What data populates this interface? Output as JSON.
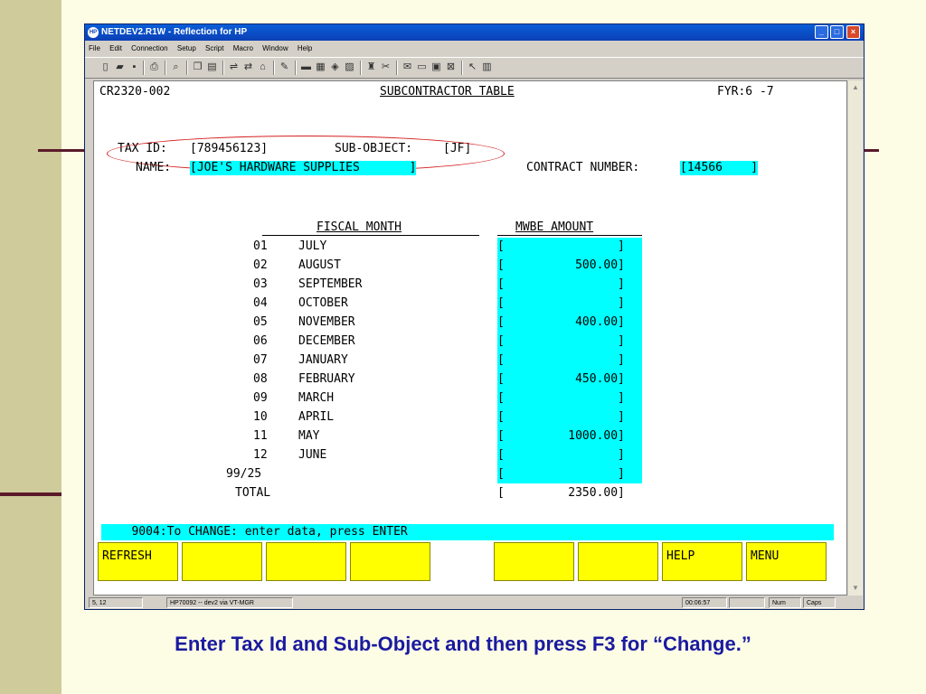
{
  "window": {
    "title": "NETDEV2.R1W - Reflection for HP",
    "app_icon": "HP",
    "controls": {
      "minimize": "_",
      "maximize": "□",
      "close": "×"
    }
  },
  "menu": [
    "File",
    "Edit",
    "Connection",
    "Setup",
    "Script",
    "Macro",
    "Window",
    "Help"
  ],
  "terminal": {
    "screen_id": "CR2320-002",
    "title": "SUBCONTRACTOR TABLE",
    "fiscal_year": "FYR:6 -7",
    "tax_id_label": "TAX ID:",
    "tax_id_value": "[789456123]",
    "sub_object_label": "SUB-OBJECT:",
    "sub_object_value": "[JF]",
    "name_label": "NAME:",
    "name_value": "[JOE'S HARDWARE SUPPLIES       ]",
    "contract_label": "CONTRACT NUMBER:",
    "contract_value": "[14566    ]",
    "col_fiscal_month": "FISCAL MONTH",
    "col_mwbe_amount": "MWBE AMOUNT",
    "rows": [
      {
        "num": "01",
        "month": "JULY",
        "amount": "[                ]"
      },
      {
        "num": "02",
        "month": "AUGUST",
        "amount": "[          500.00]"
      },
      {
        "num": "03",
        "month": "SEPTEMBER",
        "amount": "[                ]"
      },
      {
        "num": "04",
        "month": "OCTOBER",
        "amount": "[                ]"
      },
      {
        "num": "05",
        "month": "NOVEMBER",
        "amount": "[          400.00]"
      },
      {
        "num": "06",
        "month": "DECEMBER",
        "amount": "[                ]"
      },
      {
        "num": "07",
        "month": "JANUARY",
        "amount": "[                ]"
      },
      {
        "num": "08",
        "month": "FEBRUARY",
        "amount": "[          450.00]"
      },
      {
        "num": "09",
        "month": "MARCH",
        "amount": "[                ]"
      },
      {
        "num": "10",
        "month": "APRIL",
        "amount": "[                ]"
      },
      {
        "num": "11",
        "month": "MAY",
        "amount": "[         1000.00]"
      },
      {
        "num": "12",
        "month": "JUNE",
        "amount": "[                ]"
      },
      {
        "num": "99/25",
        "month": "",
        "amount": "[                ]"
      }
    ],
    "total_label": "TOTAL",
    "total_value": "[         2350.00]",
    "message": "   9004:To CHANGE: enter data, press ENTER",
    "function_keys": [
      "REFRESH",
      "",
      "",
      "",
      "",
      "",
      "",
      "HELP",
      "MENU"
    ]
  },
  "status": {
    "cursor": "5, 12",
    "session": "HP70092 -- dev2 via VT-MGR",
    "clock": "00:06:57",
    "num": "Num",
    "caps": "Caps"
  },
  "caption": "Enter Tax Id and Sub-Object and then press F3 for “Change.”",
  "colors": {
    "field_cyan": "#00ffff",
    "fkey_yellow": "#ffff00",
    "highlight_oval": "#d42020",
    "caption_blue": "#1a1aa0"
  }
}
